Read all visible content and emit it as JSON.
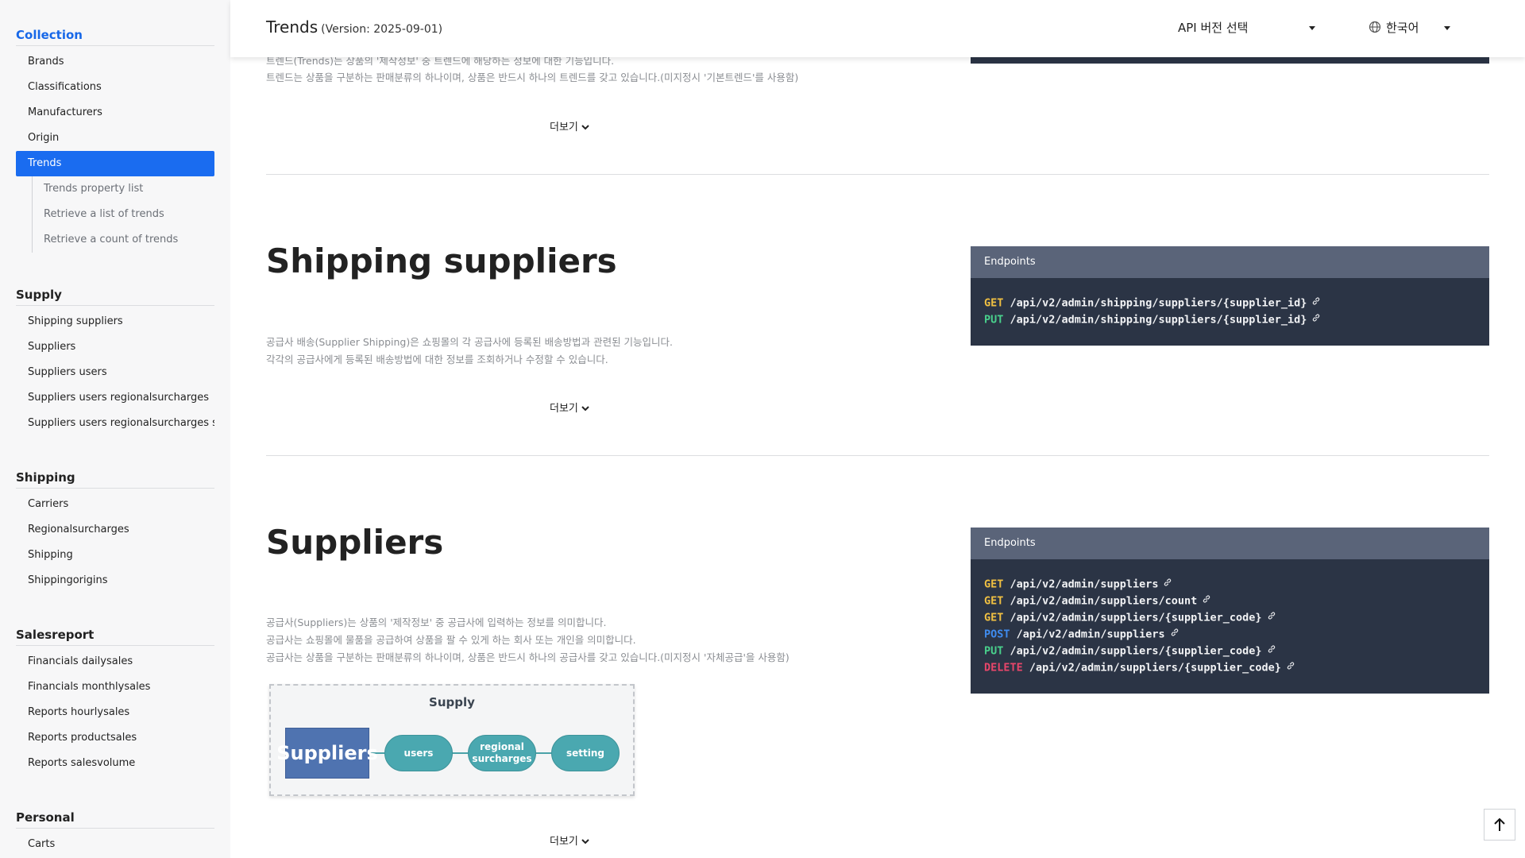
{
  "header": {
    "title": "Trends",
    "version": "(Version: 2025-09-01)",
    "api_version_select": "API 버전 선택",
    "language_select": "한국어"
  },
  "sidebar": {
    "collection": {
      "heading": "Collection",
      "items": [
        "Brands",
        "Classifications",
        "Manufacturers",
        "Origin",
        "Trends"
      ],
      "sub_items": [
        "Trends property list",
        "Retrieve a list of trends",
        "Retrieve a count of trends"
      ]
    },
    "supply": {
      "heading": "Supply",
      "items": [
        "Shipping suppliers",
        "Suppliers",
        "Suppliers users",
        "Suppliers users regionalsurcharges",
        "Suppliers users regionalsurcharges settir"
      ]
    },
    "shipping": {
      "heading": "Shipping",
      "items": [
        "Carriers",
        "Regionalsurcharges",
        "Shipping",
        "Shippingorigins"
      ]
    },
    "salesreport": {
      "heading": "Salesreport",
      "items": [
        "Financials dailysales",
        "Financials monthlysales",
        "Reports hourlysales",
        "Reports productsales",
        "Reports salesvolume"
      ]
    },
    "personal": {
      "heading": "Personal",
      "items": [
        "Carts"
      ]
    }
  },
  "trends": {
    "desc": [
      "트렌드(Trends)는 상품의 '제작정보' 중 트렌드에 해당하는 정보에 대한 기능입니다.",
      "트렌드는 상품을 구분하는 판매분류의 하나이며, 상품은 반드시 하나의 트렌드를 갖고 있습니다.(미지정시 '기본트렌드'를 사용함)"
    ],
    "more": "더보기"
  },
  "shipping_suppliers": {
    "title": "Shipping suppliers",
    "desc": [
      "공급사 배송(Supplier Shipping)은 쇼핑몰의 각 공급사에 등록된 배송방법과 관련된 기능입니다.",
      "각각의 공급사에게 등록된 배송방법에 대한 정보를 조회하거나 수정할 수 있습니다."
    ],
    "more": "더보기",
    "endpoints_label": "Endpoints",
    "endpoints": [
      {
        "method": "GET",
        "path": "/api/v2/admin/shipping/suppliers/{supplier_id}"
      },
      {
        "method": "PUT",
        "path": "/api/v2/admin/shipping/suppliers/{supplier_id}"
      }
    ]
  },
  "suppliers": {
    "title": "Suppliers",
    "desc": [
      "공급사(Suppliers)는 상품의 '제작정보' 중 공급사에 입력하는 정보를 의미합니다.",
      "공급사는 쇼핑몰에 물품을 공급하여 상품을 팔 수 있게 하는 회사 또는 개인을 의미합니다.",
      "공급사는 상품을 구분하는 판매분류의 하나이며, 상품은 반드시 하나의 공급사를 갖고 있습니다.(미지정시 '자체공급'을 사용함)"
    ],
    "more": "더보기",
    "endpoints_label": "Endpoints",
    "endpoints": [
      {
        "method": "GET",
        "path": "/api/v2/admin/suppliers"
      },
      {
        "method": "GET",
        "path": "/api/v2/admin/suppliers/count"
      },
      {
        "method": "GET",
        "path": "/api/v2/admin/suppliers/{supplier_code}"
      },
      {
        "method": "POST",
        "path": "/api/v2/admin/suppliers"
      },
      {
        "method": "PUT",
        "path": "/api/v2/admin/suppliers/{supplier_code}"
      },
      {
        "method": "DELETE",
        "path": "/api/v2/admin/suppliers/{supplier_code}"
      }
    ],
    "diagram": {
      "title": "Supply",
      "main": "Suppliers",
      "nodes": [
        "users",
        "regional surcharges",
        "setting"
      ]
    }
  },
  "colors": {
    "accent": "#1a6cf0",
    "endpoint_bg": "#2b3445",
    "endpoint_header": "#5a6479",
    "get": "#f0c042",
    "put": "#49d08c",
    "post": "#3f8cf0",
    "delete": "#e8466a"
  }
}
